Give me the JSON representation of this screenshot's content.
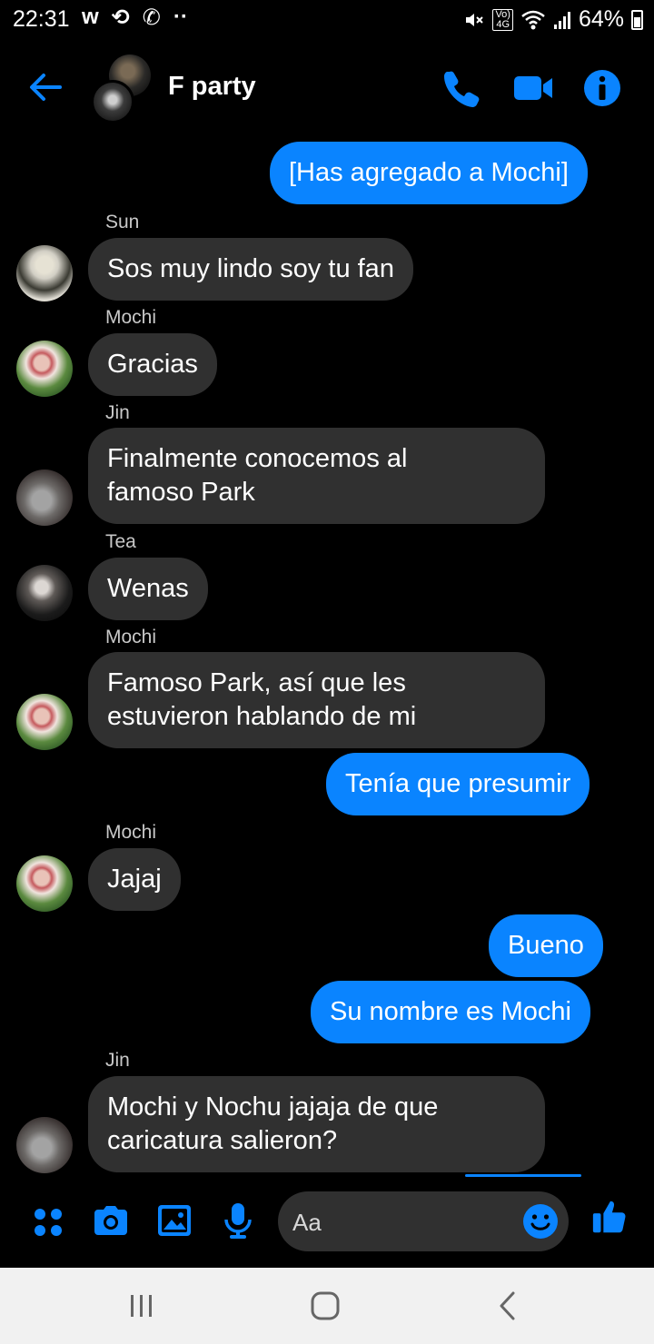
{
  "status_bar": {
    "time": "22:31",
    "battery": "64%",
    "notification_icons": [
      "wattpad-icon",
      "retweet-icon",
      "whatsapp-icon",
      "more-dots-icon"
    ],
    "system_icons": [
      "mute-icon",
      "volte-4g-icon",
      "wifi-icon",
      "signal-icon",
      "battery-icon"
    ],
    "volte_top": "Vo)",
    "volte_bottom": "4G"
  },
  "header": {
    "title": "F party"
  },
  "messages": [
    {
      "kind": "out",
      "text": "[Has agregado a Mochi]"
    },
    {
      "kind": "in",
      "sender": "Sun",
      "text": "Sos muy lindo soy tu fan"
    },
    {
      "kind": "in",
      "sender": "Mochi",
      "text": "Gracias"
    },
    {
      "kind": "in",
      "sender": "Jin",
      "text": "Finalmente conocemos al\nfamoso Park"
    },
    {
      "kind": "in",
      "sender": "Tea",
      "text": "Wenas"
    },
    {
      "kind": "in",
      "sender": "Mochi",
      "text": "Famoso Park, así que les\nestuvieron hablando de mi"
    },
    {
      "kind": "out",
      "text": "Tenía que presumir"
    },
    {
      "kind": "in",
      "sender": "Mochi",
      "text": "Jajaj"
    },
    {
      "kind": "out",
      "text": "Bueno"
    },
    {
      "kind": "out",
      "text": "Su nombre es Mochi"
    },
    {
      "kind": "in",
      "sender": "Jin",
      "text": "Mochi y Nochu jajaja de que\ncaricatura salieron?"
    }
  ],
  "composer": {
    "placeholder": "Aa"
  },
  "colors": {
    "accent": "#0a84ff",
    "incoming_bubble": "#303030",
    "background": "#000000"
  }
}
